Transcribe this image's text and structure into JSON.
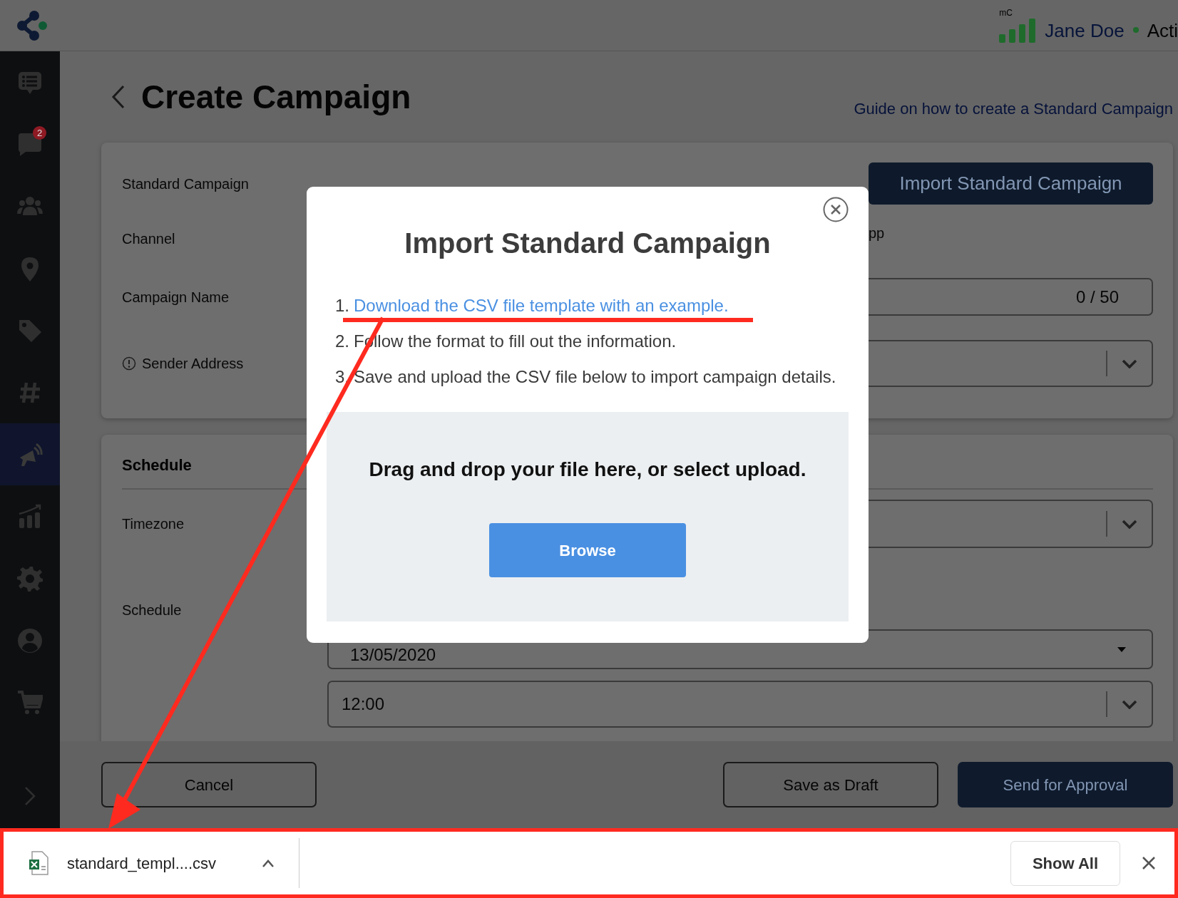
{
  "top_bar": {
    "meter_label": "mC",
    "user_name": "Jane Doe",
    "status_text": "Acti"
  },
  "sidebar": {
    "items": [
      {
        "selected": false
      },
      {
        "selected": false,
        "badge": "2"
      },
      {
        "selected": false
      },
      {
        "selected": false
      },
      {
        "selected": false
      },
      {
        "selected": false
      },
      {
        "selected": true
      },
      {
        "selected": false
      },
      {
        "selected": false
      },
      {
        "selected": false
      },
      {
        "selected": false
      }
    ]
  },
  "page": {
    "title": "Create Campaign",
    "guide_link": "Guide on how to create a Standard Campaign"
  },
  "campaign_card": {
    "import_button": "Import Standard Campaign",
    "rows": [
      {
        "kind": "blank",
        "label": "Standard Campaign"
      },
      {
        "kind": "value",
        "label": "Channel",
        "value": "pp"
      },
      {
        "kind": "input",
        "label": "Campaign Name",
        "counter": "0 / 50"
      },
      {
        "kind": "select",
        "label": "Sender Address",
        "info": true
      }
    ]
  },
  "schedule_card": {
    "heading": "Schedule",
    "timezone_label": "Timezone",
    "schedule_label": "Schedule",
    "date_value": "13/05/2020",
    "time_value": "12:00"
  },
  "footer": {
    "cancel": "Cancel",
    "save_draft": "Save as Draft",
    "submit": "Send for Approval"
  },
  "modal": {
    "title": "Import Standard Campaign",
    "steps": [
      {
        "number": "1.",
        "text": "Download the CSV file template with an example.",
        "kind": "link"
      },
      {
        "number": "2.",
        "text": "Follow the format to fill out the information.",
        "kind": "text"
      },
      {
        "number": "3.",
        "text": "Save and upload the CSV file below to import campaign details.",
        "kind": "text"
      }
    ],
    "drop_text": "Drag and drop your file here, or select upload.",
    "browse_button": "Browse"
  },
  "download_bar": {
    "file_name": "standard_templ....csv",
    "show_all": "Show All"
  }
}
